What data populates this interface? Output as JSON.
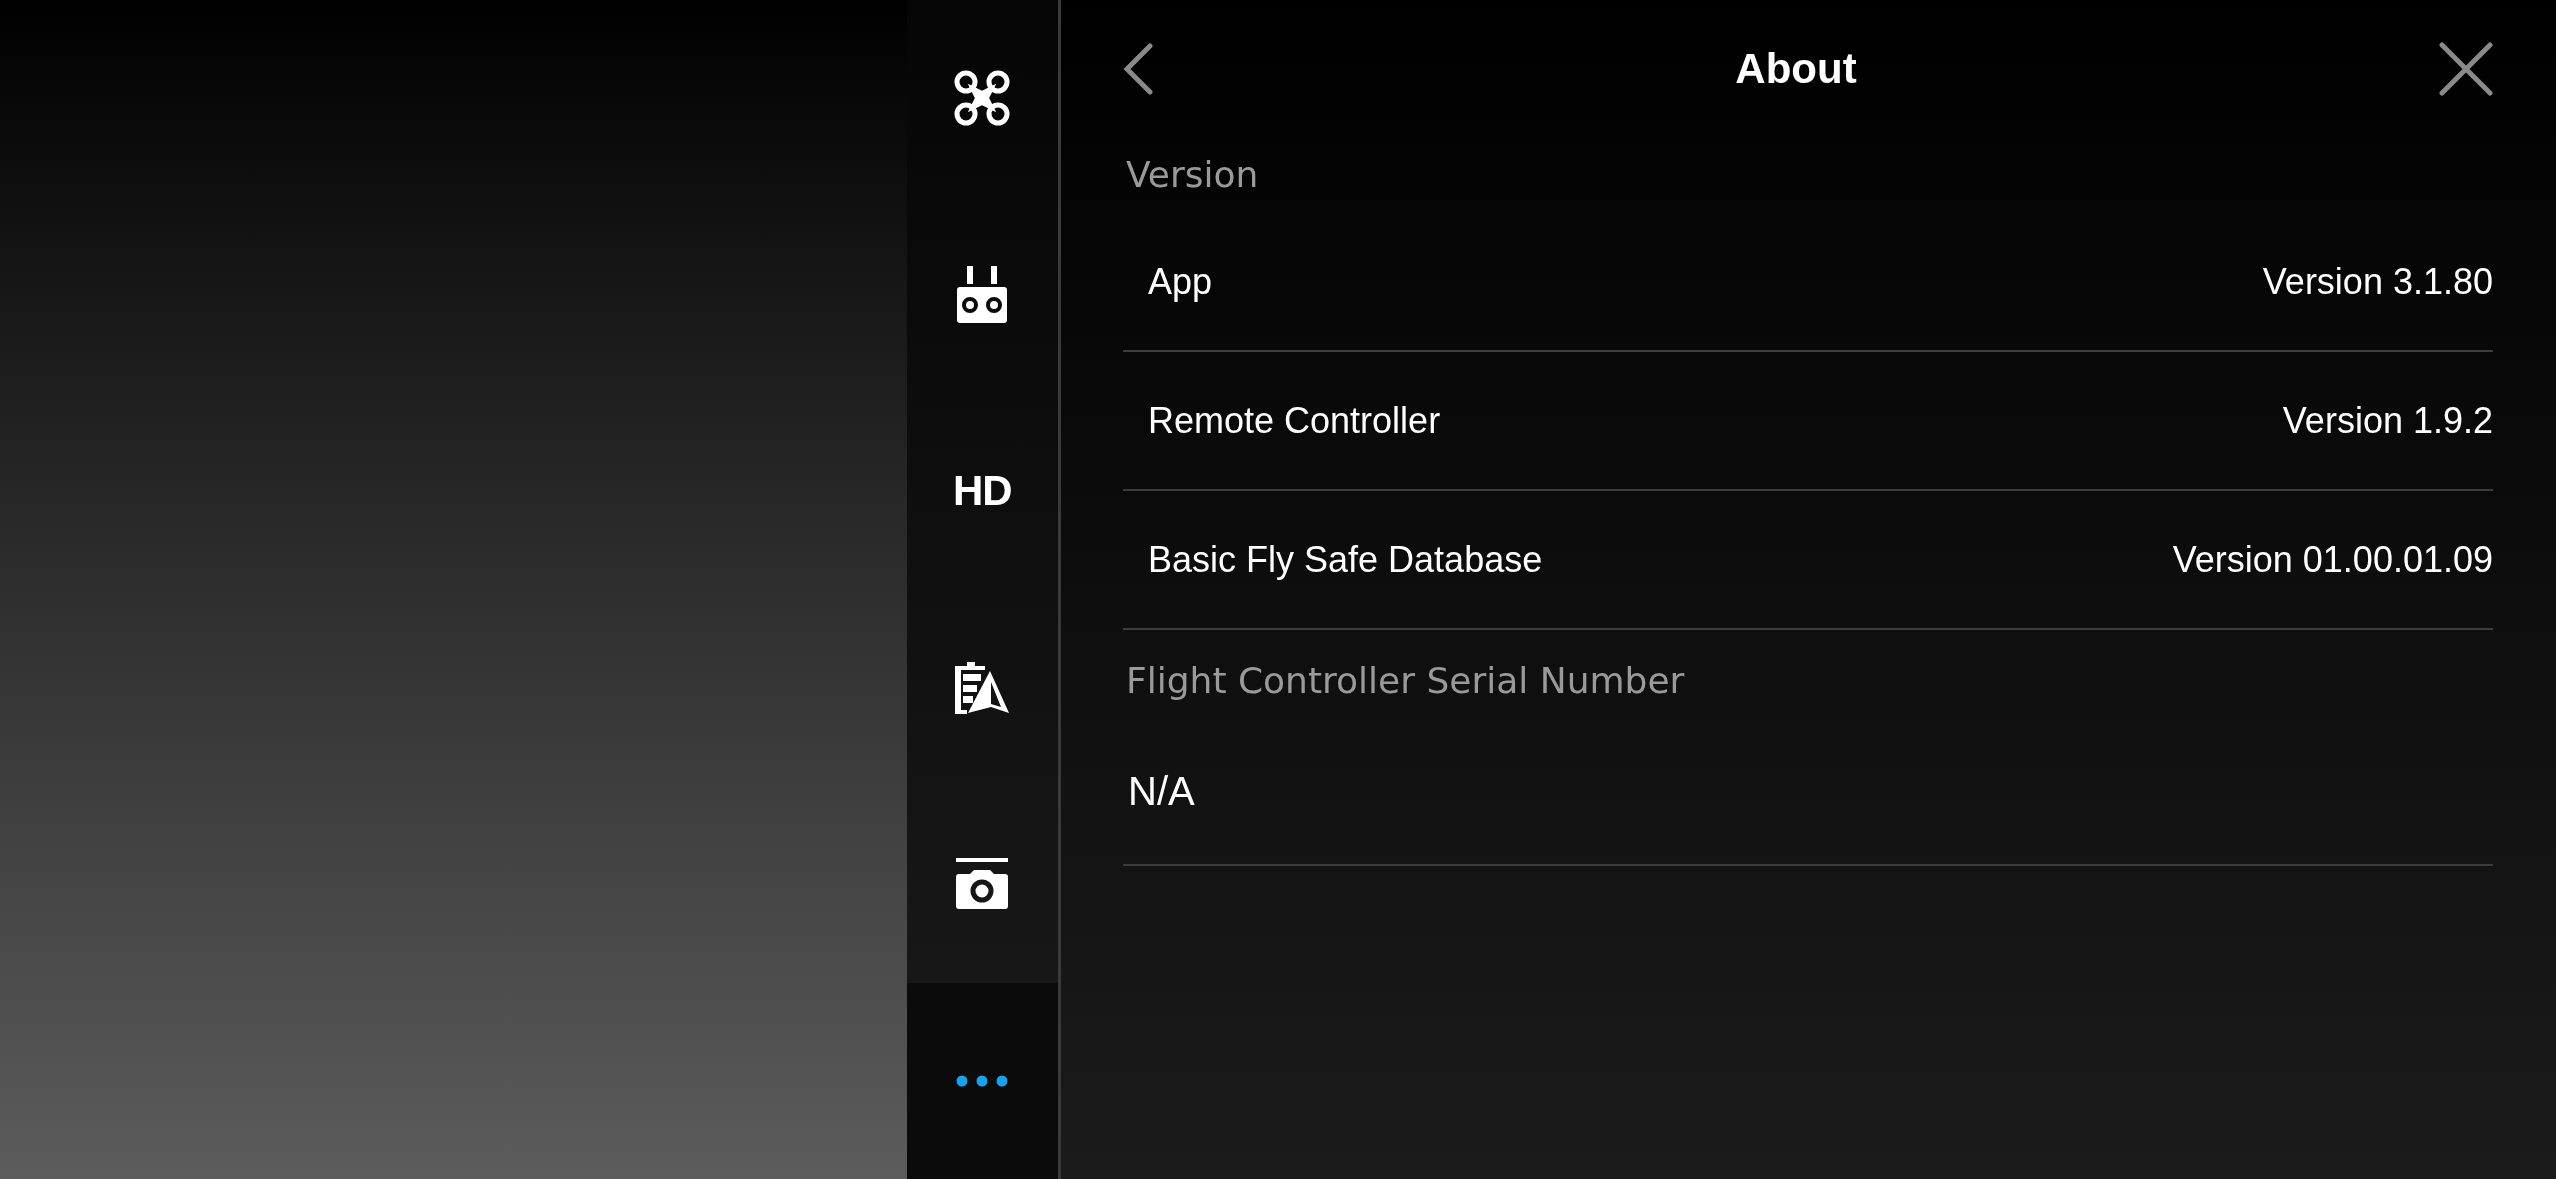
{
  "sidebar": {
    "items": [
      {
        "kind": "aircraft",
        "selected": false
      },
      {
        "kind": "remote",
        "selected": false
      },
      {
        "kind": "hd",
        "label": "HD",
        "selected": false
      },
      {
        "kind": "battery",
        "selected": false
      },
      {
        "kind": "camera",
        "selected": false
      },
      {
        "kind": "more",
        "selected": true
      }
    ]
  },
  "header": {
    "title": "About"
  },
  "sections": [
    {
      "title": "Version",
      "rows": [
        {
          "label": "App",
          "value": "Version 3.1.80"
        },
        {
          "label": "Remote Controller",
          "value": "Version 1.9.2"
        },
        {
          "label": "Basic Fly Safe Database",
          "value": "Version 01.00.01.09"
        }
      ]
    },
    {
      "title": "Flight Controller Serial Number",
      "rows": [
        {
          "value": "N/A"
        }
      ]
    }
  ]
}
